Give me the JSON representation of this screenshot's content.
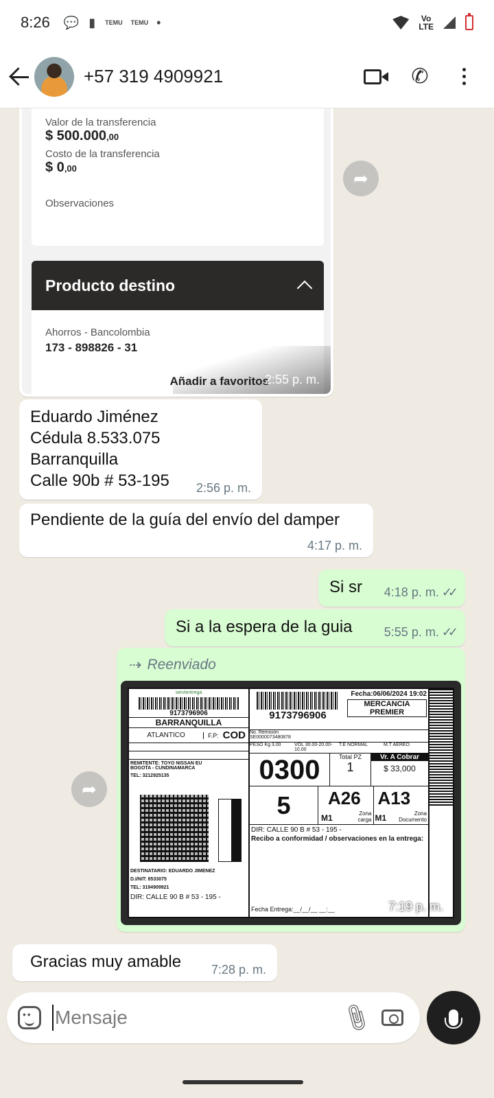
{
  "status_bar": {
    "time": "8:26",
    "notif_label_1": "TEMU",
    "notif_label_2": "TEMU",
    "network": "Vo\nLTE"
  },
  "header": {
    "contact": "+57 319 4909921"
  },
  "bank_receipt": {
    "valor_label": "Valor de la transferencia",
    "valor": "$ 500.000",
    "valor_dec": ",00",
    "costo_label": "Costo de la transferencia",
    "costo": "$ 0",
    "costo_dec": ",00",
    "obs_label": "Observaciones",
    "producto_title": "Producto destino",
    "account_type": "Ahorros - Bancolombia",
    "account_number": "173 - 898826 - 31",
    "fav_label": "Añadir a favoritos",
    "time": "2:55 p. m."
  },
  "messages": [
    {
      "text": "Eduardo Jiménez\nCédula 8.533.075\nBarranquilla\nCalle 90b # 53-195",
      "time": "2:56 p. m."
    },
    {
      "text": "Pendiente de la guía del envío del damper",
      "time": "4:17 p. m."
    },
    {
      "text": "Si sr",
      "time": "4:18 p. m."
    },
    {
      "text": "Si a la espera de la guia",
      "time": "5:55 p. m."
    },
    {
      "text": "Gracias muy amable",
      "time": "7:28 p. m."
    }
  ],
  "forwarded": {
    "label": "Reenviado",
    "time": "7:19 p. m."
  },
  "shipping_label": {
    "brand": "servientrega",
    "guide_number": "9173796906",
    "city": "BARRANQUILLA",
    "dept": "ATLANTICO",
    "fp_label": "F.P:",
    "fp_value": "COD",
    "fecha": "Fecha:06/06/2024 19:02",
    "mercancia": "MERCANCIA\nPREMIER",
    "remision": "No. Remisión\nSE0000073480878",
    "peso": "PESO Kg 3.00",
    "vol": "VOL 30.00-20.00-10.00",
    "te": "T.E NORMAL",
    "mt": "M.T AEREO",
    "route": "0300",
    "total_pz_label": "Total PZ",
    "total_pz": "1",
    "vr_cobrar_label": "Vr. A Cobrar",
    "vr_cobrar": "$ 33,000",
    "vr_cobrar_vertical": "$ 33,000",
    "code_5": "5",
    "a26": "A26",
    "a13": "A13",
    "m1": "M1",
    "zona_carga": "Zona\ncarga",
    "zona_doc": "Zona\nDocumento",
    "remitente": "REMITENTE: TOYO NISSAN EU\nBOGOTA - CUNDINAMARCA",
    "tel_rem": "TEL: 3212925135",
    "destinatario": "DESTINATARIO: EDUARDO JIMENEZ",
    "dinit": "D.I/NIT: 8533075",
    "tel_dest": "TEL: 3194909921",
    "dir": "DIR: CALLE 90 B # 53 - 195 -",
    "recibo": "Recibo a conformidad / observaciones en la entrega:",
    "fecha_entrega": "Fecha Entrega:__/__/__ __:__"
  },
  "input": {
    "placeholder": "Mensaje"
  }
}
